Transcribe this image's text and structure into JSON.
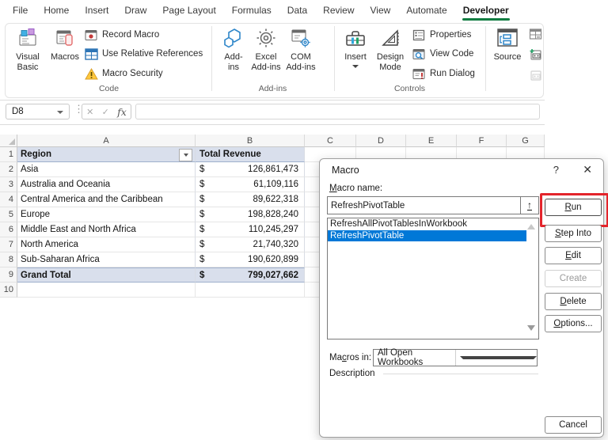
{
  "ribbon": {
    "tabs": [
      "File",
      "Home",
      "Insert",
      "Draw",
      "Page Layout",
      "Formulas",
      "Data",
      "Review",
      "View",
      "Automate",
      "Developer"
    ],
    "active_tab": "Developer",
    "groups": {
      "code": "Code",
      "addins": "Add-ins",
      "controls": "Controls"
    },
    "items": {
      "visual_basic": [
        "Visual",
        "Basic"
      ],
      "macros_big": [
        "Macros"
      ],
      "record_macro": "Record Macro",
      "use_relative_references": "Use Relative References",
      "macro_security": "Macro Security",
      "add_ins": [
        "Add-",
        "ins"
      ],
      "excel_add_ins": [
        "Excel",
        "Add-ins"
      ],
      "com_add_ins": [
        "COM",
        "Add-ins"
      ],
      "insert": [
        "Insert"
      ],
      "design_mode": [
        "Design",
        "Mode"
      ],
      "properties": "Properties",
      "view_code": "View Code",
      "run_dialog": "Run Dialog",
      "source": [
        "Source"
      ]
    }
  },
  "formula_bar": {
    "name_box": "D8",
    "formula": "",
    "fx": "fx",
    "cancel_glyph": "✕",
    "enter_glyph": "✓",
    "dots_glyph": "⋮"
  },
  "sheet": {
    "selection": "D8",
    "columns": [
      "A",
      "B",
      "C",
      "D",
      "E",
      "F",
      "G"
    ],
    "table": {
      "header": {
        "region": "Region",
        "revenue": "Total Revenue"
      },
      "currency": "$",
      "rows": [
        {
          "region": "Asia",
          "revenue": "126,861,473"
        },
        {
          "region": "Australia and Oceania",
          "revenue": "61,109,116"
        },
        {
          "region": "Central America and the Caribbean",
          "revenue": "89,622,318"
        },
        {
          "region": "Europe",
          "revenue": "198,828,240"
        },
        {
          "region": "Middle East and North Africa",
          "revenue": "110,245,297"
        },
        {
          "region": "North America",
          "revenue": "21,740,320"
        },
        {
          "region": "Sub-Saharan Africa",
          "revenue": "190,620,899"
        }
      ],
      "grand_total": {
        "region": "Grand Total",
        "revenue": "799,027,662"
      }
    }
  },
  "dialog": {
    "title": "Macro",
    "help_glyph": "?",
    "close_glyph": "✕",
    "macro_name_label": "Macro name:",
    "macro_name_value": "RefreshPivotTable",
    "field_button_glyph": "↑",
    "list": [
      "RefreshAllPivotTablesInWorkbook",
      "RefreshPivotTable"
    ],
    "selected_item": "RefreshPivotTable",
    "buttons": {
      "run": "Run",
      "step_into": "Step Into",
      "edit": "Edit",
      "create": "Create",
      "delete": "Delete",
      "options": "Options...",
      "cancel": "Cancel"
    },
    "macros_in_label": "Macros in:",
    "macros_in_value": "All Open Workbooks",
    "description_label": "Description"
  },
  "colors": {
    "developer_tab_underline": "#107C41",
    "selection_blue": "#0078D7",
    "annotation_red": "#E3242B",
    "table_header_fill": "#D9DFEC",
    "warning_yellow": "#FFC83D"
  }
}
